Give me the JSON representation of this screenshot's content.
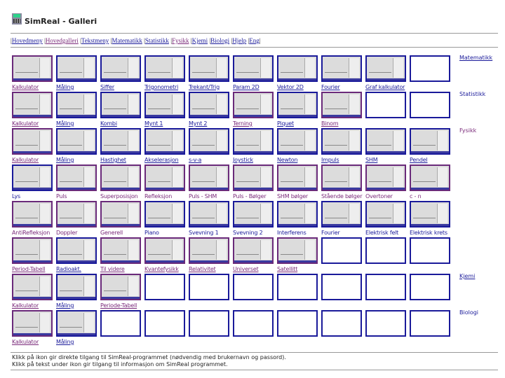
{
  "header": {
    "title": "SimReal - Galleri",
    "icon": "calculator-icon"
  },
  "nav": [
    "Hovedmeny",
    "Hovedgalleri",
    "Tekstmeny",
    "Matematikk",
    "Statistikk",
    "Fysikk",
    "Kjemi",
    "Biologi",
    "Hjelp",
    "Eng"
  ],
  "colors": {
    "link": "#1a1a9a",
    "visited": "#6a2a7a"
  },
  "side_labels": [
    {
      "label": "Matematikk",
      "row": 0
    },
    {
      "label": "Statistikk",
      "row": 1
    },
    {
      "label": "Fysikk",
      "row": 2
    },
    {
      "label": "Kjemi",
      "row": 6
    },
    {
      "label": "Biologi",
      "row": 7
    }
  ],
  "rows": [
    {
      "underline": true,
      "items": [
        [
          "Kalkulator",
          "p"
        ],
        [
          "Måling",
          "b"
        ],
        [
          "Siffer",
          "b"
        ],
        [
          "Trigonometri",
          "b"
        ],
        [
          "Trekant/Trig",
          "b"
        ],
        [
          "Param 2D",
          "b"
        ],
        [
          "Vektor 2D",
          "b"
        ],
        [
          "Fourier",
          "b"
        ],
        [
          "Graf kalkulator",
          "b"
        ],
        null
      ]
    },
    {
      "underline": true,
      "items": [
        [
          "Kalkulator",
          "p"
        ],
        [
          "Måling",
          "b"
        ],
        [
          "Kombi",
          "b"
        ],
        [
          "Mynt 1",
          "b"
        ],
        [
          "Mynt 2",
          "b"
        ],
        [
          "Terning",
          "p"
        ],
        [
          "Piquet",
          "b"
        ],
        [
          "Binom",
          "p"
        ],
        null,
        null
      ]
    },
    {
      "underline": true,
      "items": [
        [
          "Kalkulator",
          "p"
        ],
        [
          "Måling",
          "b"
        ],
        [
          "Hastighet",
          "b"
        ],
        [
          "Akselerasjon",
          "b"
        ],
        [
          "s-v-a",
          "b"
        ],
        [
          "Joystick",
          "b"
        ],
        [
          "Newton",
          "b"
        ],
        [
          "Impuls",
          "b"
        ],
        [
          "SHM",
          "b"
        ],
        [
          "Pendel",
          "b"
        ]
      ]
    },
    {
      "underline": false,
      "items": [
        [
          "Lys",
          "b"
        ],
        [
          "Puls",
          "p"
        ],
        [
          "Superposisjon",
          "p"
        ],
        [
          "Refleksjon",
          "p"
        ],
        [
          "Puls - SHM",
          "p"
        ],
        [
          "Puls - Bølger",
          "p"
        ],
        [
          "SHM bølger",
          "p"
        ],
        [
          "Stående bølger",
          "p"
        ],
        [
          "Overtoner",
          "p"
        ],
        [
          "c - n",
          "p"
        ]
      ]
    },
    {
      "underline": false,
      "items": [
        [
          "AntiRefleksjon",
          "p"
        ],
        [
          "Doppler",
          "p"
        ],
        [
          "Generell",
          "p"
        ],
        [
          "Piano",
          "b"
        ],
        [
          "Svevning 1",
          "b"
        ],
        [
          "Svevning 2",
          "b"
        ],
        [
          "Interferens",
          "b"
        ],
        [
          "Fourier",
          "b"
        ],
        [
          "Elektrisk felt",
          "b"
        ],
        [
          "Elektrisk krets",
          "b"
        ]
      ]
    },
    {
      "underline": true,
      "items": [
        [
          "Period-Tabell",
          "p"
        ],
        [
          "Radioakt.",
          "b"
        ],
        [
          "Til videre",
          "p"
        ],
        [
          "Kvantefysikk",
          "p"
        ],
        [
          "Relativitet",
          "p"
        ],
        [
          "Universet",
          "p"
        ],
        [
          "Satellitt",
          "p"
        ],
        null,
        null,
        null
      ]
    },
    {
      "underline": true,
      "items": [
        [
          "Kalkulator",
          "p"
        ],
        [
          "Måling",
          "b"
        ],
        [
          "Periode-Tabell",
          "p"
        ],
        null,
        null,
        null,
        null,
        null,
        null,
        null
      ]
    },
    {
      "underline": true,
      "items": [
        [
          "Kalkulator",
          "p"
        ],
        [
          "Måling",
          "b"
        ],
        null,
        null,
        null,
        null,
        null,
        null,
        null,
        null
      ]
    }
  ],
  "footer": [
    "Klikk på ikon gir direkte tilgang til SimReal-programmet (nødvendig med brukernavn og passord).",
    "Klikk på tekst under ikon gir tilgang til informasjon om SimReal programmet."
  ]
}
